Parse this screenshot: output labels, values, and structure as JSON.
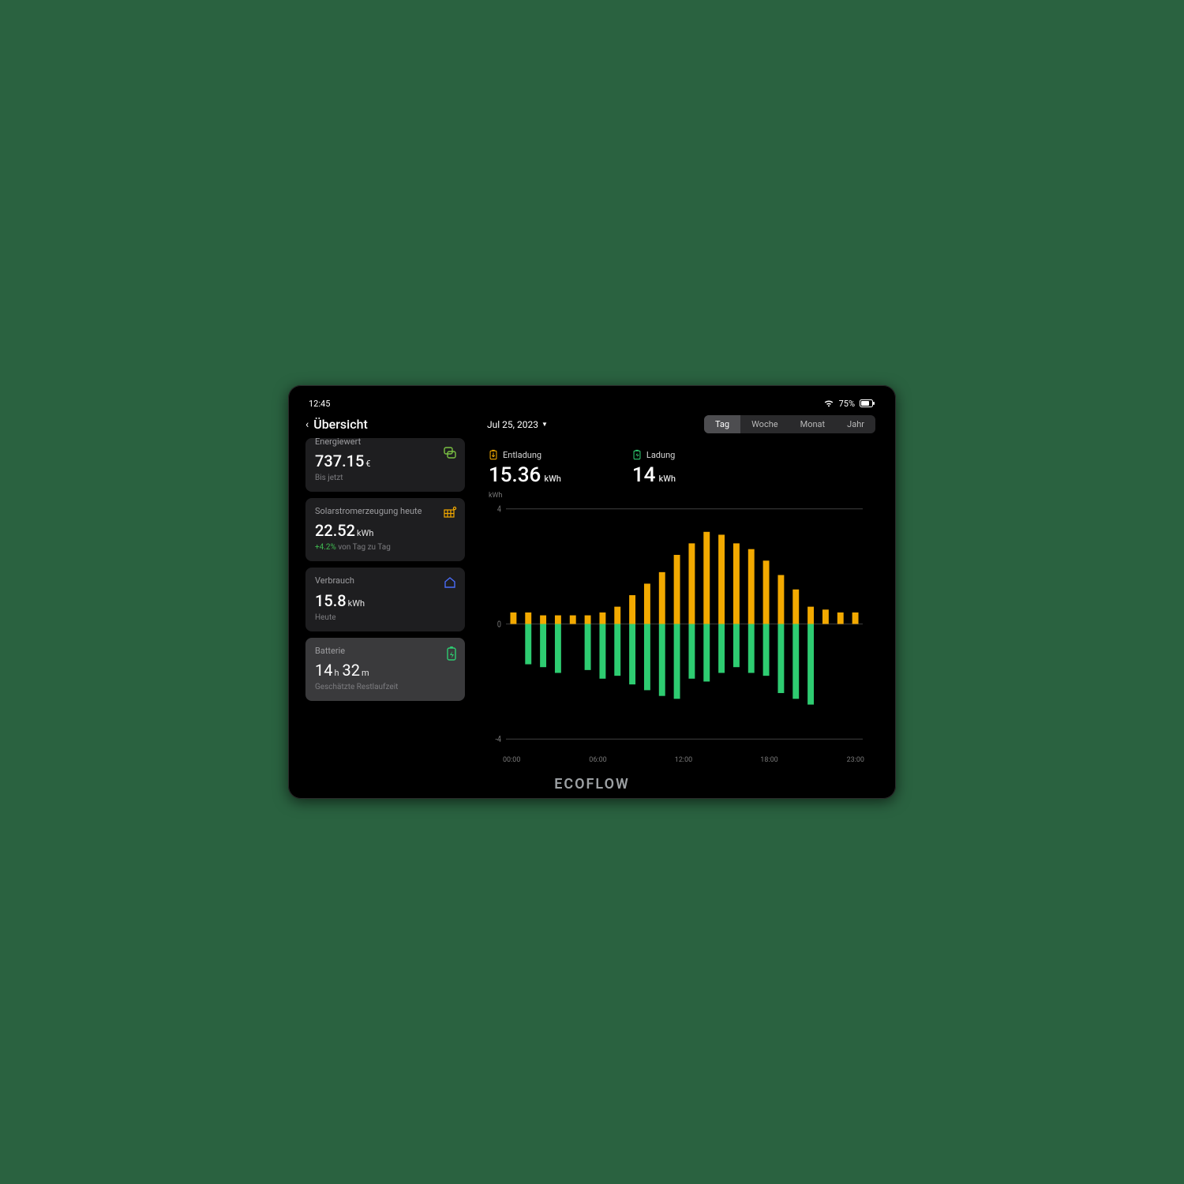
{
  "statusbar": {
    "time": "12:45",
    "battery_pct": "75%"
  },
  "header": {
    "title": "Übersicht",
    "date": "Jul 25, 2023",
    "ranges": {
      "tag": "Tag",
      "woche": "Woche",
      "monat": "Monat",
      "jahr": "Jahr",
      "active": "Tag"
    }
  },
  "sidebar": {
    "energiewert": {
      "label": "Energiewert",
      "value": "737.15",
      "unit": "€",
      "sub": "Bis jetzt"
    },
    "solar": {
      "label": "Solarstromerzeugung heute",
      "value": "22.52",
      "unit": "kWh",
      "delta": "+4.2%",
      "delta_sub": " von Tag zu Tag"
    },
    "verbrauch": {
      "label": "Verbrauch",
      "value": "15.8",
      "unit": "kWh",
      "sub": "Heute"
    },
    "batterie": {
      "label": "Batterie",
      "hours": "14",
      "h_unit": "h",
      "minutes": "32",
      "m_unit": "m",
      "sub": "Geschätzte Restlaufzeit"
    }
  },
  "main": {
    "entladung": {
      "label": "Entladung",
      "value": "15.36",
      "unit": "kWh"
    },
    "ladung": {
      "label": "Ladung",
      "value": "14",
      "unit": "kWh"
    },
    "y_unit": "kWh"
  },
  "chart_data": {
    "type": "bar",
    "title": "",
    "xlabel": "",
    "ylabel": "kWh",
    "ylim": [
      -4,
      4
    ],
    "y_ticks": [
      -4,
      0,
      4
    ],
    "x_ticks": [
      "00:00",
      "06:00",
      "12:00",
      "18:00",
      "23:00"
    ],
    "categories": [
      "00:00",
      "01:00",
      "02:00",
      "03:00",
      "04:00",
      "05:00",
      "06:00",
      "07:00",
      "08:00",
      "09:00",
      "10:00",
      "11:00",
      "12:00",
      "13:00",
      "14:00",
      "15:00",
      "16:00",
      "17:00",
      "18:00",
      "19:00",
      "20:00",
      "21:00",
      "22:00",
      "23:00"
    ],
    "series": [
      {
        "name": "Entladung",
        "color": "#f2a900",
        "values": [
          0.4,
          0.4,
          0.3,
          0.3,
          0.3,
          0.3,
          0.4,
          0.6,
          1.0,
          1.4,
          1.8,
          2.4,
          2.8,
          3.2,
          3.1,
          2.8,
          2.6,
          2.2,
          1.7,
          1.2,
          0.6,
          0.5,
          0.4,
          0.4
        ]
      },
      {
        "name": "Ladung",
        "color": "#2ecc71",
        "values": [
          0,
          -1.4,
          -1.5,
          -1.7,
          0,
          -1.6,
          -1.9,
          -1.8,
          -2.1,
          -2.3,
          -2.5,
          -2.6,
          -1.9,
          -2.0,
          -1.7,
          -1.5,
          -1.7,
          -1.8,
          -2.4,
          -2.6,
          -2.8,
          0,
          0,
          0
        ]
      }
    ]
  },
  "brand": "ECOFLOW",
  "colors": {
    "orange": "#f2a900",
    "green": "#2ecc71",
    "blue": "#4a6cf7",
    "lime": "#7ac142"
  }
}
